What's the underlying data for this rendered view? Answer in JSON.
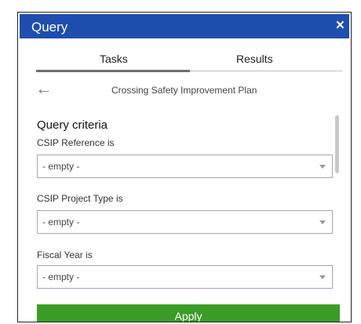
{
  "window": {
    "title": "Query",
    "close_glyph": "×"
  },
  "tabs": [
    {
      "label": "Tasks",
      "active": true
    },
    {
      "label": "Results",
      "active": false
    }
  ],
  "task": {
    "back_glyph": "←",
    "name": "Crossing Safety Improvement Plan"
  },
  "criteria": {
    "title": "Query criteria",
    "fields": [
      {
        "label": "CSIP Reference is",
        "value": "- empty -"
      },
      {
        "label": "CSIP Project Type is",
        "value": "- empty -"
      },
      {
        "label": "Fiscal Year is",
        "value": "- empty -"
      }
    ]
  },
  "apply_label": "Apply",
  "colors": {
    "header": "#1f4eaf",
    "apply": "#3a9c26"
  }
}
